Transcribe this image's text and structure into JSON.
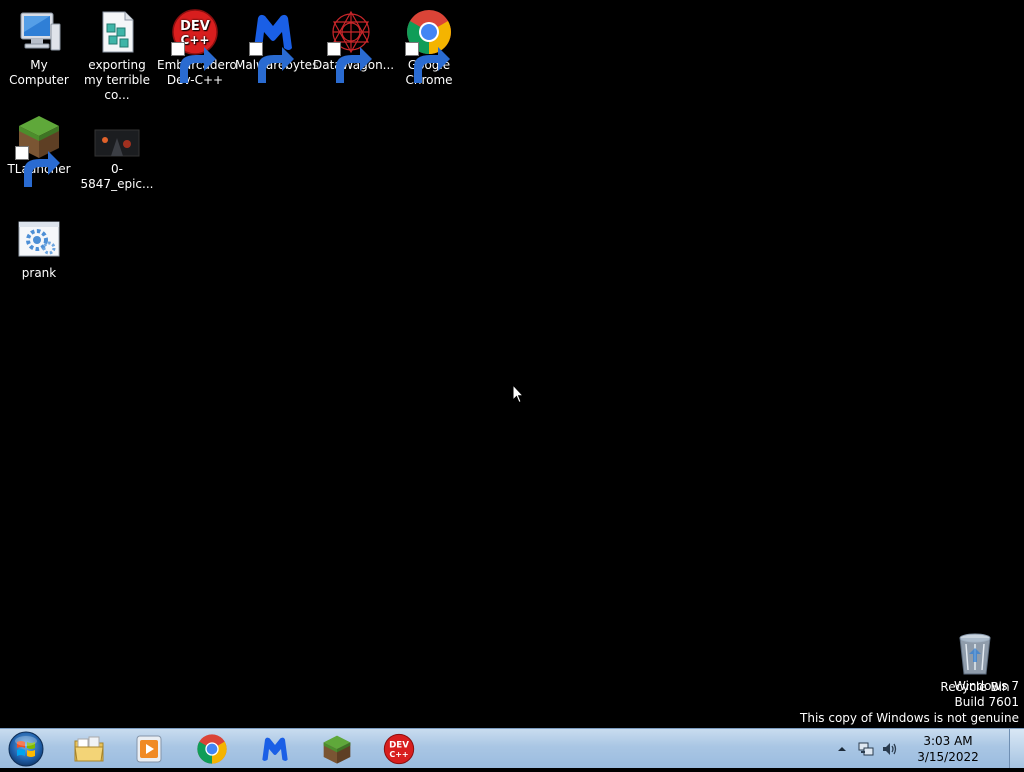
{
  "desktop_icons": [
    {
      "label": "My Computer",
      "icon": "computer-icon"
    },
    {
      "label": "exporting my terrible co...",
      "icon": "registry-file-icon"
    },
    {
      "label": "Embarcadero Dev-C++",
      "icon": "devcpp-icon"
    },
    {
      "label": "Malwarebytes",
      "icon": "malwarebytes-icon"
    },
    {
      "label": "DataWagon...",
      "icon": "datawagon-icon"
    },
    {
      "label": "Google Chrome",
      "icon": "chrome-icon"
    },
    {
      "label": "TLauncher",
      "icon": "tlauncher-icon"
    },
    {
      "label": "0-5847_epic...",
      "icon": "image-thumbnail-icon"
    },
    {
      "label": "prank",
      "icon": "settings-file-icon"
    },
    {
      "label": "Recycle Bin",
      "icon": "recycle-bin-icon"
    }
  ],
  "watermark": {
    "line1": "Windows 7",
    "line2": "Build 7601",
    "line3": "This copy of Windows is not genuine"
  },
  "taskbar": {
    "pinned": [
      "explorer-icon",
      "media-player-icon",
      "chrome-icon",
      "malwarebytes-icon",
      "tlauncher-icon",
      "devcpp-icon"
    ]
  },
  "tray": {
    "time": "3:03 AM",
    "date": "3/15/2022"
  },
  "colors": {
    "desktop_background": "#000000",
    "taskbar": "#a9c6e4",
    "chrome_red": "#db4437",
    "chrome_green": "#0f9d58",
    "chrome_yellow": "#f4b400",
    "chrome_blue": "#4285f4",
    "malwarebytes_blue": "#1a5fe6",
    "devcpp_red": "#d81e1e"
  }
}
